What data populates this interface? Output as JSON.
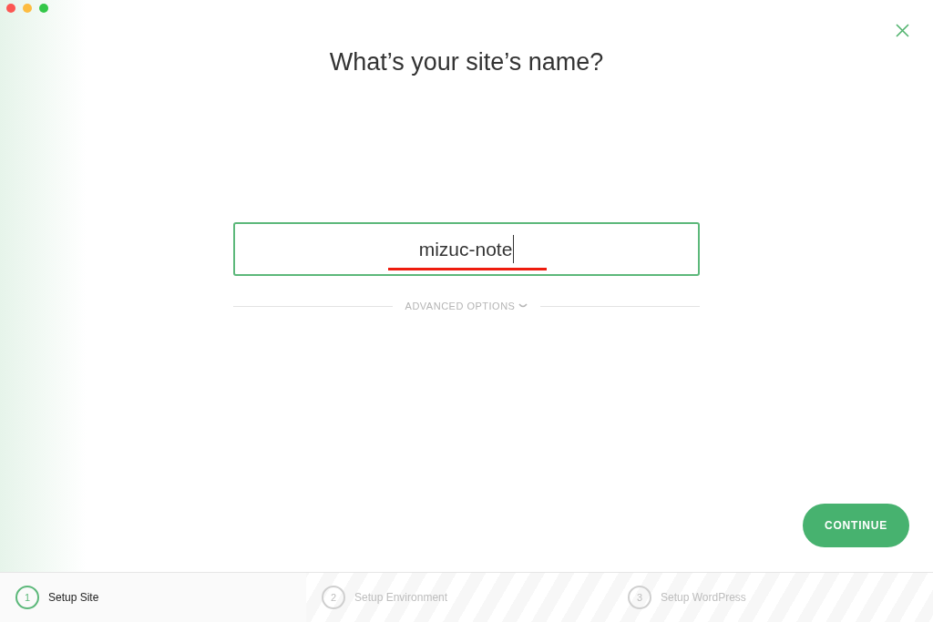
{
  "title": "What’s your site’s name?",
  "site_name": {
    "value": "mizuc-note"
  },
  "advanced_options": {
    "label": "ADVANCED OPTIONS",
    "expanded": false
  },
  "continue_button": "CONTINUE",
  "steps": [
    {
      "number": "1",
      "label": "Setup Site",
      "selected": true
    },
    {
      "number": "2",
      "label": "Setup Environment",
      "selected": false
    },
    {
      "number": "3",
      "label": "Setup WordPress",
      "selected": false
    }
  ]
}
